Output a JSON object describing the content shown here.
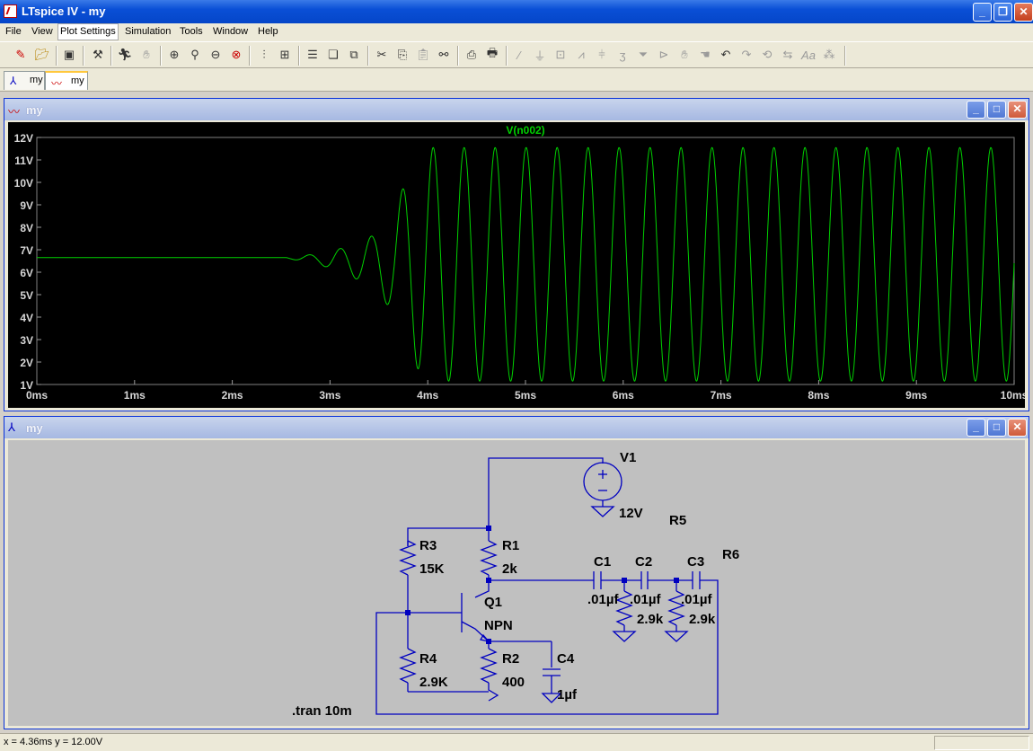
{
  "window": {
    "title": "LTspice IV - my",
    "minimize": "_",
    "restore": "❐",
    "close": "✕"
  },
  "menu": [
    "File",
    "View",
    "Plot Settings",
    "Simulation",
    "Tools",
    "Window",
    "Help"
  ],
  "toolbar": {
    "icons": [
      "new-schematic-icon",
      "open-icon",
      "save-icon",
      "control-panel-icon",
      "run-icon",
      "halt-icon",
      "zoom-in-icon",
      "zoom-pan-icon",
      "zoom-out-icon",
      "zoom-fit-icon",
      "autorange-icon",
      "mark-data-icon",
      "tile-horizontal-icon",
      "cascade-icon",
      "close-window-icon",
      "cut-icon",
      "copy-icon",
      "paste-icon",
      "find-icon",
      "print-setup-icon",
      "print-icon",
      "wire-icon",
      "ground-icon",
      "label-net-icon",
      "resistor-icon",
      "capacitor-icon",
      "inductor-icon",
      "diode-icon",
      "component-icon",
      "move-icon",
      "drag-icon",
      "undo-icon",
      "redo-icon",
      "rotate-icon",
      "mirror-icon",
      "text-icon",
      "spice-directive-icon"
    ]
  },
  "tabs": [
    {
      "label": "my",
      "icon": "schematic-icon"
    },
    {
      "label": "my",
      "icon": "waveform-icon"
    }
  ],
  "plot_window": {
    "title": "my",
    "chart_data": {
      "type": "line",
      "title": "V(n002)",
      "xlabel": "",
      "ylabel": "",
      "xlim": [
        0,
        10
      ],
      "ylim": [
        1,
        12
      ],
      "x_ticks": [
        "0ms",
        "1ms",
        "2ms",
        "3ms",
        "4ms",
        "5ms",
        "6ms",
        "7ms",
        "8ms",
        "9ms",
        "10ms"
      ],
      "y_ticks": [
        "1V",
        "2V",
        "3V",
        "4V",
        "5V",
        "6V",
        "7V",
        "8V",
        "9V",
        "10V",
        "11V",
        "12V"
      ],
      "series": [
        {
          "name": "V(n002)",
          "color": "#00d000",
          "steady_start": {
            "x": 0,
            "y": 6.65
          },
          "growth_start_x": 2.55,
          "period_ms": 0.317,
          "amplitude_points": [
            [
              2.55,
              0.02
            ],
            [
              2.9,
              0.25
            ],
            [
              3.2,
              0.65
            ],
            [
              3.45,
              1.2
            ],
            [
              3.65,
              2.2
            ],
            [
              3.8,
              4.0
            ],
            [
              3.95,
              5.0
            ],
            [
              4.05,
              5.2
            ],
            [
              10,
              5.2
            ]
          ],
          "center_v": 6.35
        }
      ]
    }
  },
  "schematic_window": {
    "title": "my",
    "labels": {
      "v1": "V1",
      "v1_val": "12V",
      "r1": "R1",
      "r1_val": "2k",
      "r2": "R2",
      "r2_val": "400",
      "r3": "R3",
      "r3_val": "15K",
      "r4": "R4",
      "r4_val": "2.9K",
      "r5": "R5",
      "r6": "R6",
      "q1": "Q1",
      "q1_val": "NPN",
      "c1": "C1",
      "c1_val": ".01µf",
      "c2": "C2",
      "c2_val": ".01µf",
      "c3": "C3",
      "c3_val": ".01µf",
      "c4": "C4",
      "c4_val": "1µf",
      "rp1_val": "2.9k",
      "rp2_val": "2.9k",
      "directive": ".tran 10m"
    },
    "wire_color": "#0000c0"
  },
  "status": {
    "text": "x = 4.36ms    y = 12.00V"
  }
}
